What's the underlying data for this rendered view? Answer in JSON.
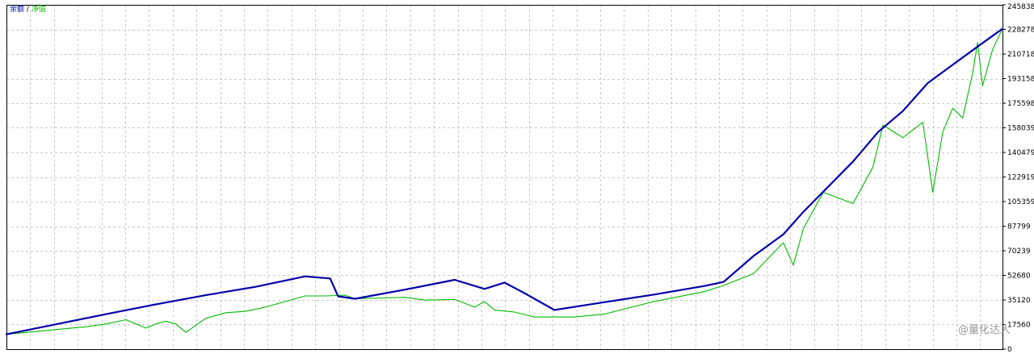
{
  "chart_data": {
    "type": "line",
    "ylim": [
      0,
      245838
    ],
    "yticks": [
      {
        "label": "245838",
        "value": 245838
      },
      {
        "label": "228278",
        "value": 228278
      },
      {
        "label": "210718",
        "value": 210718
      },
      {
        "label": "193158",
        "value": 193158
      },
      {
        "label": "175598",
        "value": 175598
      },
      {
        "label": "158039",
        "value": 158039
      },
      {
        "label": "140479",
        "value": 140479
      },
      {
        "label": "122919",
        "value": 122919
      },
      {
        "label": "105359",
        "value": 105359
      },
      {
        "label": "87799",
        "value": 87799
      },
      {
        "label": "70239",
        "value": 70239
      },
      {
        "label": "52680",
        "value": 52680
      },
      {
        "label": "35120",
        "value": 35120
      },
      {
        "label": "17560",
        "value": 17560
      },
      {
        "label": "0",
        "value": 0
      }
    ],
    "xlim": [
      0,
      100
    ],
    "grid": true,
    "legend_position": "top-left",
    "legend_separator": " / ",
    "series": [
      {
        "name": "余额",
        "color": "#0000aa",
        "x": [
          0,
          5,
          10,
          15,
          20,
          25,
          30,
          32.5,
          33.3,
          35,
          40,
          45,
          48,
          50,
          52,
          55,
          60,
          65,
          70,
          72,
          75,
          78,
          80,
          85,
          87.5,
          90,
          92.5,
          95,
          97.5,
          100
        ],
        "y": [
          10600,
          17800,
          25000,
          32000,
          38500,
          44500,
          52000,
          50500,
          37700,
          36000,
          42500,
          49500,
          43000,
          47500,
          40000,
          28000,
          33500,
          39000,
          45000,
          48000,
          66500,
          82000,
          98000,
          134000,
          155000,
          170000,
          190000,
          203000,
          216000,
          228800
        ]
      },
      {
        "name": "净值",
        "color": "#00bb00",
        "x": [
          0,
          8,
          10,
          12,
          14,
          15,
          16,
          17,
          18,
          20,
          22,
          24,
          26,
          28,
          30,
          32,
          34,
          35,
          40,
          42,
          45,
          47,
          48,
          49,
          51,
          53,
          55,
          57,
          60,
          65,
          70,
          72,
          75,
          78,
          79,
          80,
          82,
          85,
          87,
          88,
          90,
          92,
          93,
          94,
          95,
          96,
          97,
          97.5,
          98,
          99,
          100
        ],
        "y": [
          10600,
          16000,
          18000,
          21000,
          15000,
          18000,
          20000,
          18000,
          12000,
          22000,
          26000,
          27000,
          30000,
          34000,
          38000,
          38000,
          38500,
          36000,
          37000,
          35000,
          35500,
          30000,
          34000,
          28000,
          26500,
          23000,
          23000,
          23000,
          25000,
          34000,
          41000,
          45500,
          54000,
          76000,
          60000,
          86000,
          112000,
          104000,
          130000,
          160000,
          151000,
          162000,
          112000,
          155000,
          172000,
          165000,
          197000,
          219000,
          188000,
          214000,
          228800
        ]
      }
    ],
    "watermark": "@量化达人"
  }
}
